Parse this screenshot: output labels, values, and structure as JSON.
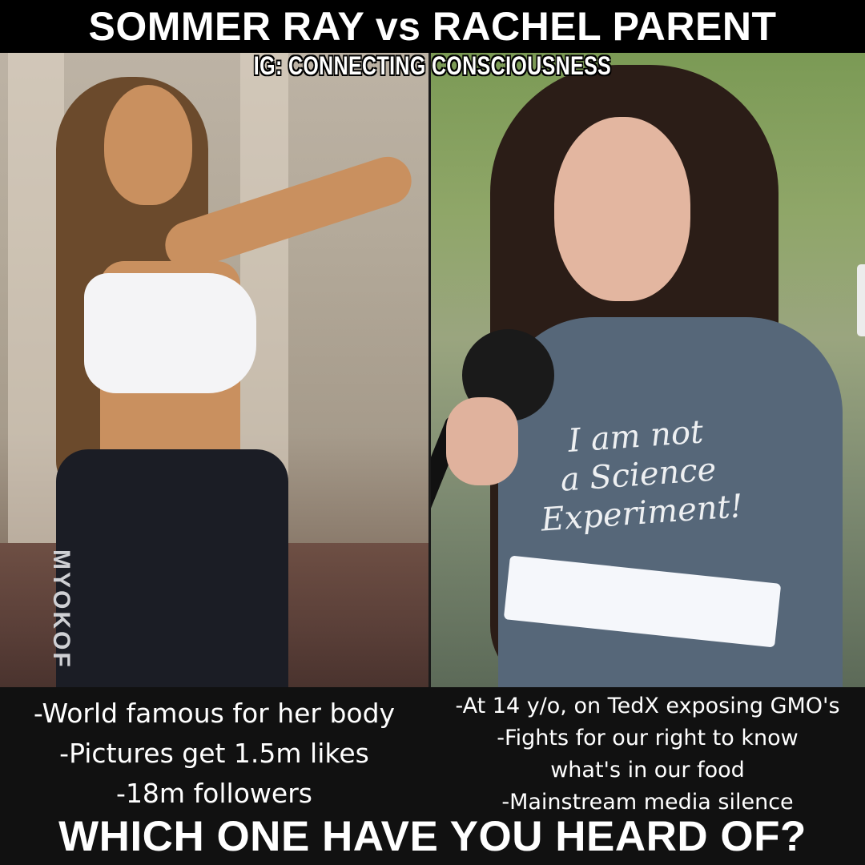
{
  "header": {
    "title": "SOMMER RAY vs RACHEL PARENT",
    "ig_credit": "IG: CONNECTING CONSCIOUSNESS"
  },
  "left_photo": {
    "pants_text": "MYOKOF"
  },
  "right_photo": {
    "shirt_line1": "I am not",
    "shirt_line2": "a Science",
    "shirt_line3": "Experiment!"
  },
  "left_facts": [
    "-World famous for her body",
    "-Pictures get 1.5m likes",
    "-18m followers"
  ],
  "right_facts": [
    "-At 14 y/o, on TedX exposing GMO's",
    "-Fights for our right to know",
    "what's in our food",
    "-Mainstream media silence"
  ],
  "footer": {
    "question": "WHICH ONE HAVE YOU HEARD OF?"
  },
  "colors": {
    "background": "#0b0b0b",
    "text": "#ffffff",
    "header_bg": "#000000"
  }
}
